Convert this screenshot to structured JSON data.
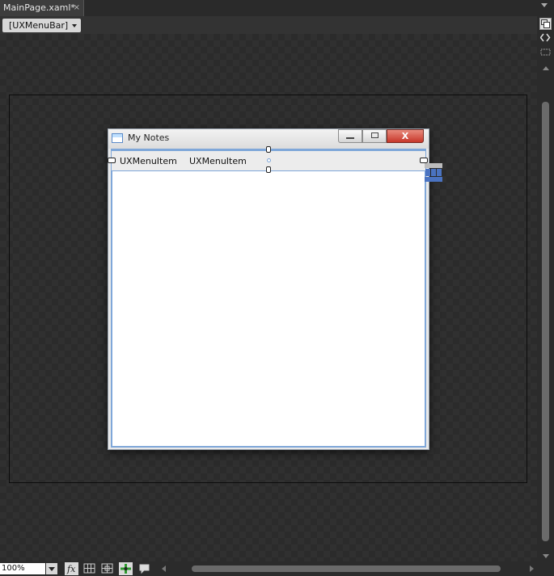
{
  "tab": {
    "label": "MainPage.xaml*",
    "close": "×"
  },
  "breadcrumb": {
    "label": "[UXMenuBar]"
  },
  "window": {
    "title": "My Notes",
    "close_glyph": "X",
    "menu_items": [
      "UXMenuItem",
      "UXMenuItem"
    ]
  },
  "status": {
    "zoom": "100%"
  },
  "colors": {
    "accent": "#4a73c1",
    "selection": "#7fa7d9",
    "close_button": "#c7372a"
  },
  "icons": [
    "close-icon",
    "chevron-down-icon",
    "artboard-icon",
    "code-icon",
    "split-icon",
    "fx-icon",
    "grid-icon",
    "snap-icon",
    "effects-icon",
    "annotation-icon"
  ]
}
